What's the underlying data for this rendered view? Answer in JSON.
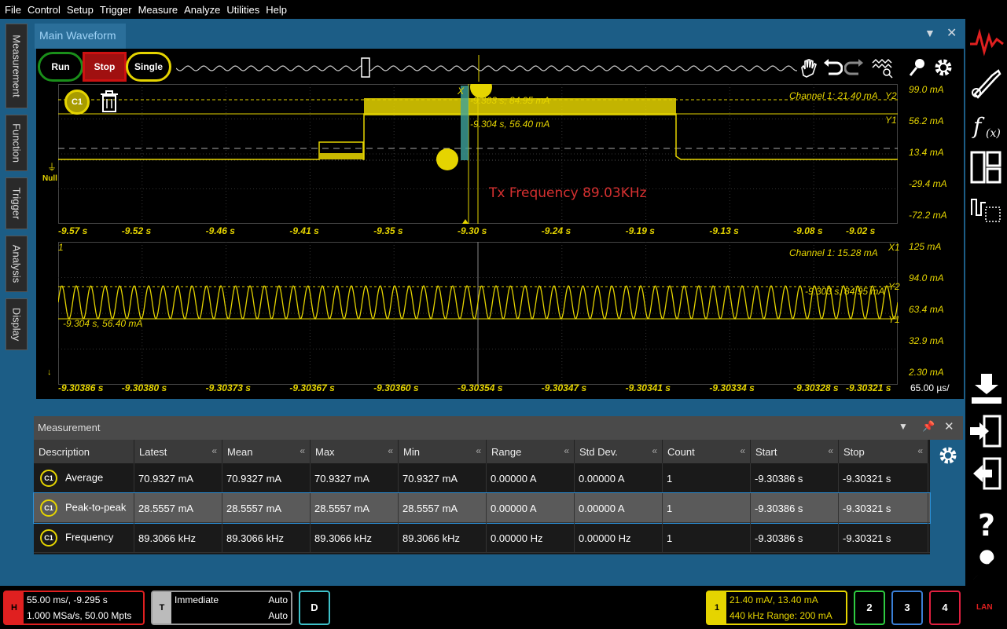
{
  "menu": [
    "File",
    "Control",
    "Setup",
    "Trigger",
    "Measure",
    "Analyze",
    "Utilities",
    "Help"
  ],
  "left_tabs": [
    "Measurement",
    "Function",
    "Trigger",
    "Analysis",
    "Display"
  ],
  "main_window": {
    "title": "Main Waveform",
    "buttons": {
      "run": "Run",
      "stop": "Stop",
      "single": "Single"
    },
    "channel_badge": "C1",
    "upper": {
      "channel_label": "Channel 1:  21.40 mA",
      "y_marker_2": "Y2",
      "y_marker_1": "Y1",
      "x_marker": "X",
      "cursor_a": "-9.303 s, 84.95 mA",
      "cursor_b": "-9.304 s, 56.40 mA",
      "null_label": "Null",
      "annotation": "Tx Frequency 89.03KHz",
      "time_labels": [
        "-9.57 s",
        "-9.52 s",
        "-9.46 s",
        "-9.41 s",
        "-9.35 s",
        "-9.30 s",
        "-9.24 s",
        "-9.19 s",
        "-9.13 s",
        "-9.08 s",
        "-9.02 s"
      ],
      "scale": [
        "99.0 mA",
        "56.2 mA",
        "13.4 mA",
        "-29.4 mA",
        "-72.2 mA"
      ]
    },
    "lower": {
      "channel_label": "Channel 1:  15.28 mA",
      "x_marker": "X1",
      "y2": "Y2",
      "y1": "Y1",
      "ch_marker": "1",
      "cursor_a": "-9.303 s, 84.95 mA",
      "cursor_b": "-9.304 s, 56.40 mA",
      "time_labels": [
        "-9.30386 s",
        "-9.30380 s",
        "-9.30373 s",
        "-9.30367 s",
        "-9.30360 s",
        "-9.30354 s",
        "-9.30347 s",
        "-9.30341 s",
        "-9.30334 s",
        "-9.30328 s",
        "-9.30321 s"
      ],
      "time_per_div": "65.00 µs/",
      "scale": [
        "125 mA",
        "94.0 mA",
        "63.4 mA",
        "32.9 mA",
        "2.30 mA"
      ]
    }
  },
  "measurement": {
    "title": "Measurement",
    "columns": [
      "Description",
      "Latest",
      "Mean",
      "Max",
      "Min",
      "Range",
      "Std Dev.",
      "Count",
      "Start",
      "Stop"
    ],
    "rows": [
      {
        "badge": "C1",
        "cells": [
          "Average",
          "70.9327 mA",
          "70.9327 mA",
          "70.9327 mA",
          "70.9327 mA",
          "0.00000 A",
          "0.00000 A",
          "1",
          "-9.30386 s",
          "-9.30321 s"
        ]
      },
      {
        "badge": "C1",
        "cells": [
          "Peak-to-peak",
          "28.5557 mA",
          "28.5557 mA",
          "28.5557 mA",
          "28.5557 mA",
          "0.00000 A",
          "0.00000 A",
          "1",
          "-9.30386 s",
          "-9.30321 s"
        ]
      },
      {
        "badge": "C1",
        "cells": [
          "Frequency",
          "89.3066 kHz",
          "89.3066 kHz",
          "89.3066 kHz",
          "89.3066 kHz",
          "0.00000 Hz",
          "0.00000 Hz",
          "1",
          "-9.30386 s",
          "-9.30321 s"
        ]
      }
    ]
  },
  "status": {
    "horiz_tag": "H",
    "horiz_line1": "55.00 ms/, -9.295 s",
    "horiz_line2": "1.000 MSa/s, 50.00 Mpts",
    "trig_tag": "T",
    "trig_mode": "Immediate",
    "trig_auto1": "Auto",
    "trig_auto2": "Auto",
    "digital": "D",
    "ch1_tag": "1",
    "ch1_line1": "21.40 mA/, 13.40 mA",
    "ch1_line2": "440 kHz  Range: 200 mA",
    "ch2": "2",
    "ch3": "3",
    "ch4": "4",
    "lan": "LAN"
  },
  "colors": {
    "accent": "#1c5d86",
    "trace": "#e5d400",
    "stop": "#cc1111",
    "run": "#1a8f1a"
  }
}
